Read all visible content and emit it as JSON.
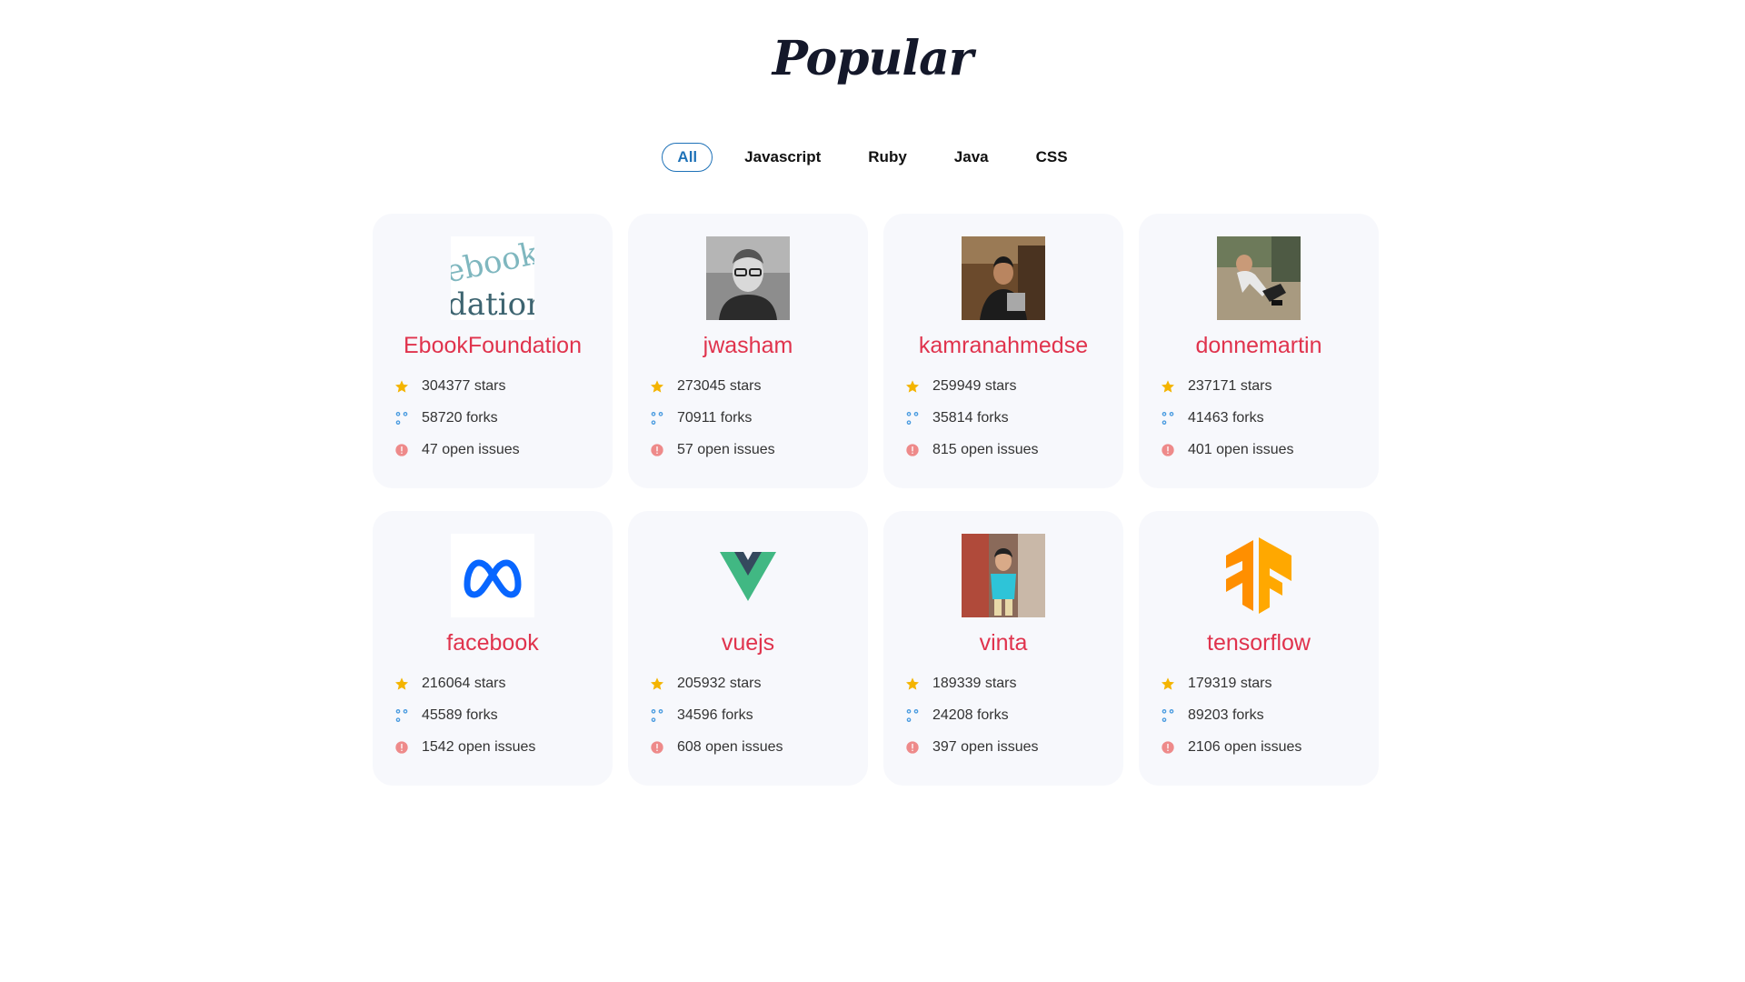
{
  "header": {
    "title": "Popular"
  },
  "tabs": [
    {
      "label": "All",
      "active": true
    },
    {
      "label": "Javascript",
      "active": false
    },
    {
      "label": "Ruby",
      "active": false
    },
    {
      "label": "Java",
      "active": false
    },
    {
      "label": "CSS",
      "active": false
    }
  ],
  "colors": {
    "accent": "#1f72b8",
    "repo_name": "#e0334d",
    "star": "#f4b400",
    "fork": "#4a9be0",
    "issue": "#ee8a8a",
    "card_bg": "#f7f8fc"
  },
  "repos": [
    {
      "name": "EbookFoundation",
      "stars": "304377 stars",
      "forks": "58720 forks",
      "issues": "47 open issues",
      "avatar": "ebookfoundation-logo-avatar"
    },
    {
      "name": "jwasham",
      "stars": "273045 stars",
      "forks": "70911 forks",
      "issues": "57 open issues",
      "avatar": "portrait-photo-avatar"
    },
    {
      "name": "kamranahmedse",
      "stars": "259949 stars",
      "forks": "35814 forks",
      "issues": "815 open issues",
      "avatar": "portrait-photo-avatar"
    },
    {
      "name": "donnemartin",
      "stars": "237171 stars",
      "forks": "41463 forks",
      "issues": "401 open issues",
      "avatar": "portrait-photo-avatar"
    },
    {
      "name": "facebook",
      "stars": "216064 stars",
      "forks": "45589 forks",
      "issues": "1542 open issues",
      "avatar": "meta-logo-avatar"
    },
    {
      "name": "vuejs",
      "stars": "205932 stars",
      "forks": "34596 forks",
      "issues": "608 open issues",
      "avatar": "vue-logo-avatar"
    },
    {
      "name": "vinta",
      "stars": "189339 stars",
      "forks": "24208 forks",
      "issues": "397 open issues",
      "avatar": "portrait-photo-avatar"
    },
    {
      "name": "tensorflow",
      "stars": "179319 stars",
      "forks": "89203 forks",
      "issues": "2106 open issues",
      "avatar": "tensorflow-logo-avatar"
    }
  ]
}
